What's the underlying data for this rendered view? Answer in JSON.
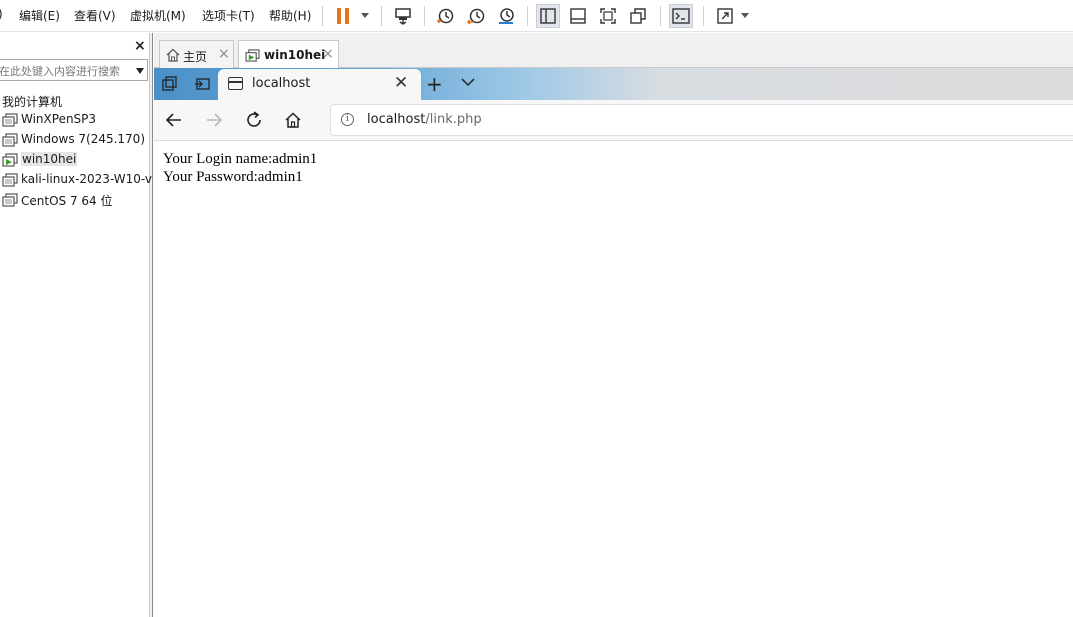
{
  "menubar": {
    "items": [
      "编辑(E)",
      "查看(V)",
      "虚拟机(M)",
      "选项卡(T)",
      "帮助(H)"
    ],
    "leading_fragment": ")",
    "icons": [
      "pause-icon",
      "send-ctrl-alt-del-icon",
      "snapshot-icon",
      "revert-snapshot-icon",
      "snapshot-manager-icon",
      "library-view-icon",
      "thumbnail-bar-icon",
      "fullscreen-icon",
      "unity-icon",
      "console-view-icon",
      "stretch-guest-icon"
    ],
    "accent": "#e8731a"
  },
  "library": {
    "close_label": "×",
    "search_placeholder": "在此处键入内容进行搜索",
    "root": "我的计算机",
    "vms": [
      {
        "name": "WinXPenSP3",
        "running": false
      },
      {
        "name": "Windows 7(245.170)",
        "running": false
      },
      {
        "name": "win10hei",
        "running": true,
        "selected": true
      },
      {
        "name": "kali-linux-2023-W10-v",
        "running": false
      },
      {
        "name": "CentOS 7 64 位",
        "running": false
      }
    ]
  },
  "vm_tabs": [
    {
      "label": "主页",
      "icon": "home-icon",
      "close": "×"
    },
    {
      "label": "win10hei",
      "icon": "vm-running-icon",
      "close": "×",
      "active": true
    }
  ],
  "browser": {
    "tab_title": "localhost",
    "tab_close": "✕",
    "new_tab": "+",
    "address": {
      "host": "localhost",
      "path": "/link.php",
      "info": "i"
    },
    "content": {
      "line1": "Your Login name:admin1",
      "line2": "Your Password:admin1"
    }
  }
}
